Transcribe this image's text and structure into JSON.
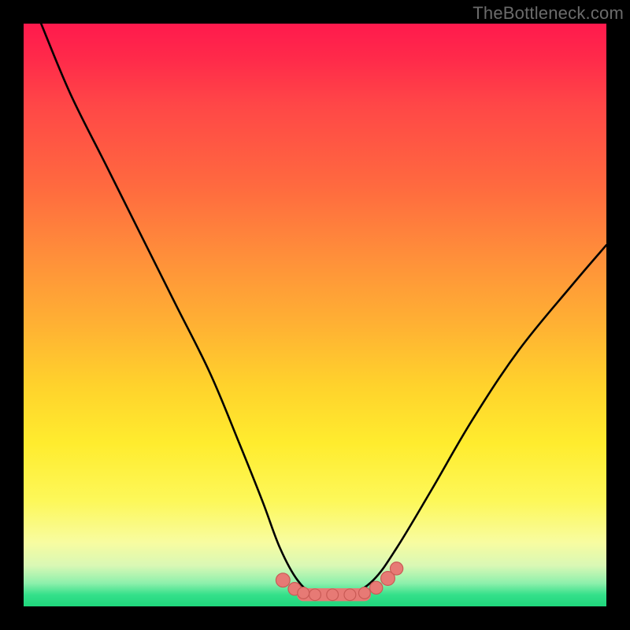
{
  "watermark": "TheBottleneck.com",
  "colors": {
    "frame": "#000000",
    "curve_stroke": "#000000",
    "marker_fill": "#e77a75",
    "marker_stroke": "#c95a55"
  },
  "chart_data": {
    "type": "line",
    "title": "",
    "xlabel": "",
    "ylabel": "",
    "xlim": [
      0,
      100
    ],
    "ylim": [
      0,
      100
    ],
    "grid": false,
    "legend": false,
    "note": "No axis ticks or numeric labels are visible; values are relative plot-fraction estimates (0–100).",
    "series": [
      {
        "name": "curve",
        "x": [
          3,
          8,
          14,
          20,
          26,
          32,
          37,
          41,
          44,
          47,
          50,
          53,
          56,
          60,
          64,
          70,
          77,
          85,
          94,
          100
        ],
        "y": [
          100,
          88,
          76,
          64,
          52,
          40,
          28,
          18,
          10,
          4.5,
          2,
          2,
          2,
          4.5,
          10,
          20,
          32,
          44,
          55,
          62
        ]
      }
    ],
    "markers": [
      {
        "x": 44.5,
        "y": 4.5,
        "r": 1.2
      },
      {
        "x": 46.5,
        "y": 3.0,
        "r": 1.1
      },
      {
        "x": 48.0,
        "y": 2.3,
        "r": 1.0
      },
      {
        "x": 50.0,
        "y": 2.0,
        "r": 1.0
      },
      {
        "x": 53.0,
        "y": 2.0,
        "r": 1.0
      },
      {
        "x": 56.0,
        "y": 2.0,
        "r": 1.0
      },
      {
        "x": 58.5,
        "y": 2.3,
        "r": 1.0
      },
      {
        "x": 60.5,
        "y": 3.2,
        "r": 1.1
      },
      {
        "x": 62.5,
        "y": 4.8,
        "r": 1.2
      },
      {
        "x": 64.0,
        "y": 6.5,
        "r": 1.1
      }
    ],
    "flat_segment": {
      "x0": 48.0,
      "x1": 58.5,
      "y": 2.0,
      "thickness": 2.2
    }
  }
}
